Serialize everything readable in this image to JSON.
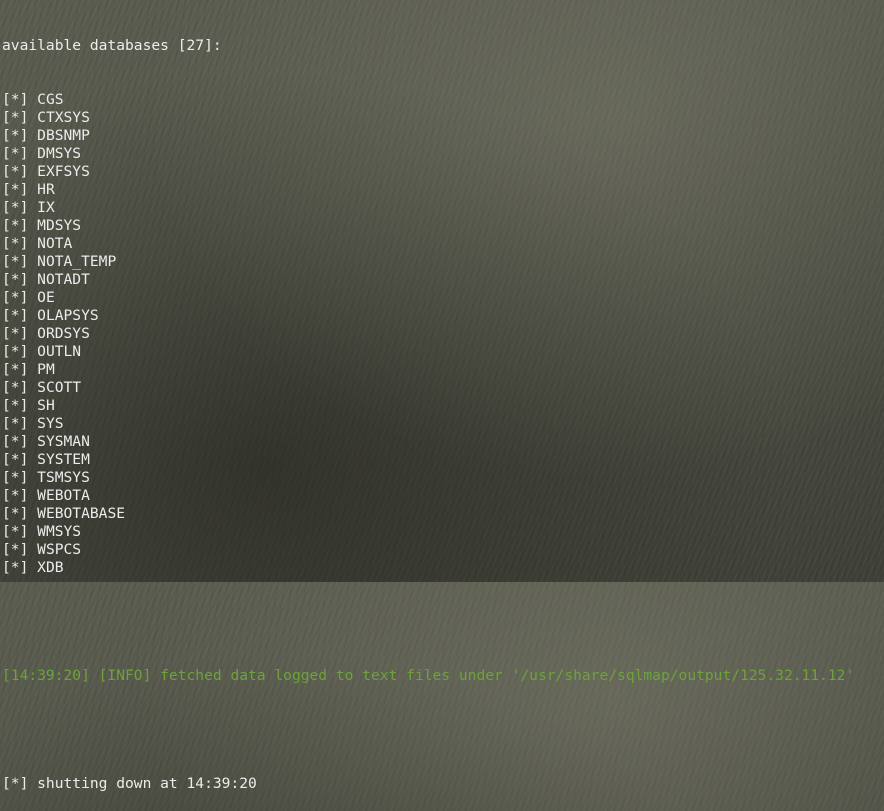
{
  "terminal": {
    "header": "available databases [27]:",
    "bullet": "[*]",
    "databases": [
      "CGS",
      "CTXSYS",
      "DBSNMP",
      "DMSYS",
      "EXFSYS",
      "HR",
      "IX",
      "MDSYS",
      "NOTA",
      "NOTA_TEMP",
      "NOTADT",
      "OE",
      "OLAPSYS",
      "ORDSYS",
      "OUTLN",
      "PM",
      "SCOTT",
      "SH",
      "SYS",
      "SYSMAN",
      "SYSTEM",
      "TSMSYS",
      "WEBOTA",
      "WEBOTABASE",
      "WMSYS",
      "WSPCS",
      "XDB"
    ],
    "info_line": "[14:39:20] [INFO] fetched data logged to text files under '/usr/share/sqlmap/output/125.32.11.12'",
    "shutdown_line": "[*] shutting down at 14:39:20"
  },
  "colors": {
    "text": "#ececec",
    "info": "#6ca43a",
    "background": "#55574b"
  }
}
